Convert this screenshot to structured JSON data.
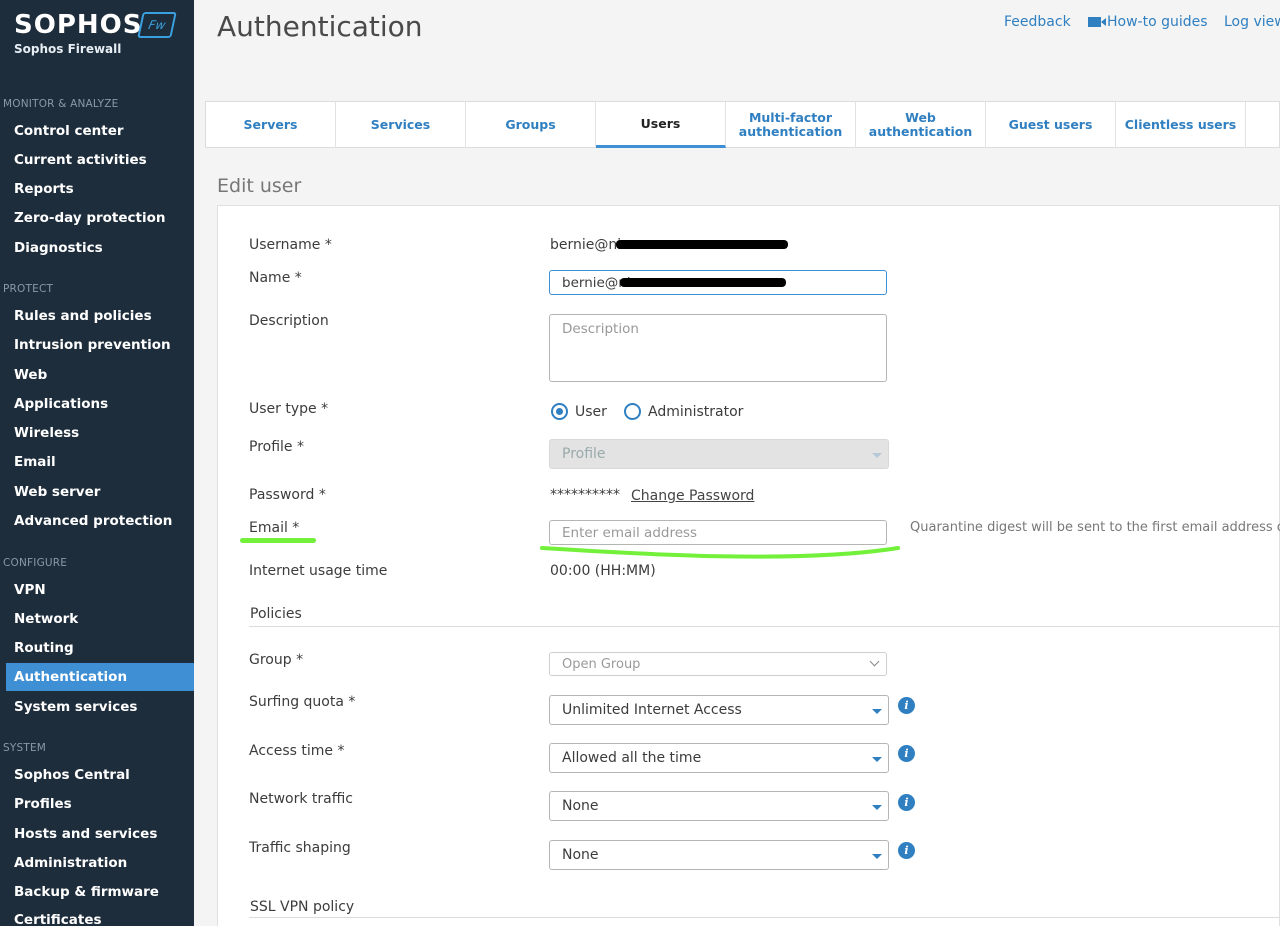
{
  "brand": {
    "name": "SOPHOS",
    "product": "Sophos Firewall",
    "badge": "Fw"
  },
  "sidebar": {
    "sections": [
      {
        "title": "MONITOR & ANALYZE",
        "items": [
          "Control center",
          "Current activities",
          "Reports",
          "Zero-day protection",
          "Diagnostics"
        ]
      },
      {
        "title": "PROTECT",
        "items": [
          "Rules and policies",
          "Intrusion prevention",
          "Web",
          "Applications",
          "Wireless",
          "Email",
          "Web server",
          "Advanced protection"
        ]
      },
      {
        "title": "CONFIGURE",
        "items": [
          "VPN",
          "Network",
          "Routing",
          "Authentication",
          "System services"
        ]
      },
      {
        "title": "SYSTEM",
        "items": [
          "Sophos Central",
          "Profiles",
          "Hosts and services",
          "Administration",
          "Backup & firmware",
          "Certificates"
        ]
      }
    ],
    "active": "Authentication"
  },
  "header": {
    "title": "Authentication",
    "feedback": "Feedback",
    "howto": "How-to guides",
    "logview": "Log viewer"
  },
  "tabs": [
    "Servers",
    "Services",
    "Groups",
    "Users",
    "Multi-factor authentication",
    "Web authentication",
    "Guest users",
    "Clientless users"
  ],
  "active_tab": "Users",
  "form": {
    "section_title": "Edit user",
    "username_label": "Username *",
    "username_value": "bernie@ni",
    "name_label": "Name *",
    "name_value": "bernie@ni",
    "description_label": "Description",
    "description_placeholder": "Description",
    "usertype_label": "User type *",
    "usertype_user": "User",
    "usertype_admin": "Administrator",
    "usertype_selected": "User",
    "profile_label": "Profile *",
    "profile_value": "Profile",
    "password_label": "Password *",
    "password_value": "**********",
    "change_password": "Change Password",
    "email_label": "Email *",
    "email_placeholder": "Enter email address",
    "email_note": "Quarantine digest will be sent to the first email address only.",
    "internet_label": "Internet usage time",
    "internet_value": "00:00 (HH:MM)",
    "policies_title": "Policies",
    "group_label": "Group *",
    "group_value": "Open Group",
    "surfing_label": "Surfing quota *",
    "surfing_value": "Unlimited Internet Access",
    "access_label": "Access time *",
    "access_value": "Allowed all the time",
    "network_label": "Network traffic",
    "network_value": "None",
    "shaping_label": "Traffic shaping",
    "shaping_value": "None",
    "sslvpn_title": "SSL VPN policy"
  },
  "colors": {
    "sidebar": "#1e2d3b",
    "accent": "#3e8fd4",
    "link": "#2f7fc1",
    "highlight": "#72f03a"
  }
}
